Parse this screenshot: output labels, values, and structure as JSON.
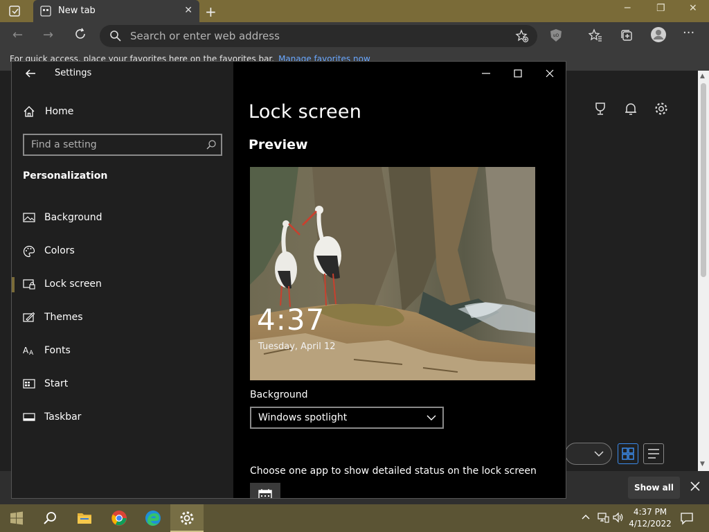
{
  "browser": {
    "tab_title": "New tab",
    "address_placeholder": "Search or enter web address",
    "favorites_bar_text": "For quick access, place your favorites here on the favorites bar.",
    "favorites_bar_link": "Manage favorites now",
    "show_all_label": "Show all"
  },
  "settings": {
    "window_title": "Settings",
    "home_label": "Home",
    "search_placeholder": "Find a setting",
    "section_title": "Personalization",
    "nav_items": [
      {
        "label": "Background",
        "icon": "image-icon"
      },
      {
        "label": "Colors",
        "icon": "palette-icon"
      },
      {
        "label": "Lock screen",
        "icon": "lock-screen-icon",
        "selected": true
      },
      {
        "label": "Themes",
        "icon": "brush-icon"
      },
      {
        "label": "Fonts",
        "icon": "font-icon"
      },
      {
        "label": "Start",
        "icon": "start-icon"
      },
      {
        "label": "Taskbar",
        "icon": "taskbar-icon"
      }
    ],
    "page_title": "Lock screen",
    "preview_heading": "Preview",
    "preview_time": "4:37",
    "preview_date": "Tuesday, April 12",
    "background_label": "Background",
    "background_value": "Windows spotlight",
    "app_status_label": "Choose one app to show detailed status on the lock screen"
  },
  "taskbar": {
    "clock_time": "4:37 PM",
    "clock_date": "4/12/2022"
  },
  "colors": {
    "accent": "#7a6b38",
    "taskbar": "#5b5434",
    "link": "#6aa8ff"
  }
}
